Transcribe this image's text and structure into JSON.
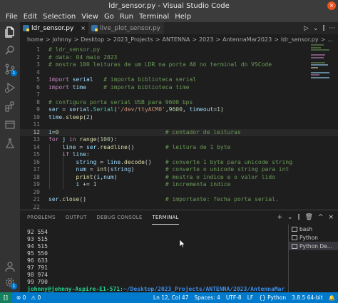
{
  "window": {
    "title": "ldr_sensor.py - Visual Studio Code",
    "close_glyph": "×"
  },
  "menu": [
    "File",
    "Edit",
    "Selection",
    "View",
    "Go",
    "Run",
    "Terminal",
    "Help"
  ],
  "tabs": [
    {
      "label": "ldr_sensor.py",
      "close": "×"
    },
    {
      "label": "live_plot_sensor.py"
    }
  ],
  "editor_actions": {
    "run": "▷",
    "run_dropdown": "⌄",
    "split": "⫿",
    "more": "···"
  },
  "breadcrumb": {
    "parts": [
      "home",
      "johnny",
      "Desktop",
      "2023_Projects",
      "ANTENNA",
      "2023",
      "AntennaMar2023",
      "ldr_sensor.py",
      "..."
    ],
    "separator": ">"
  },
  "code_lines": [
    {
      "num": "1",
      "code": "# ldr_sensor.py"
    },
    {
      "num": "2",
      "code": "# data: 04 maio 2023"
    },
    {
      "num": "3",
      "code": "# mostra 100 leituras de um LDR na porta A0 no terminal do VSCode"
    },
    {
      "num": "4",
      "code": ""
    },
    {
      "num": "5",
      "code": "import serial   # importa biblioteca serial"
    },
    {
      "num": "6",
      "code": "import time     # importa biblioteca time"
    },
    {
      "num": "7",
      "code": ""
    },
    {
      "num": "8",
      "code": "# configura porta serial USB para 9600 bps"
    },
    {
      "num": "9",
      "code": "ser = serial.Serial('/dev/ttyACM0',9600, timeout=1)"
    },
    {
      "num": "10",
      "code": "time.sleep(2)"
    },
    {
      "num": "11",
      "code": ""
    },
    {
      "num": "12",
      "code": "i=0                               # contador de leituras"
    },
    {
      "num": "13",
      "code": "for j in range(100):"
    },
    {
      "num": "14",
      "code": "    line = ser.readline()         # leitura de 1 byte"
    },
    {
      "num": "15",
      "code": "    if line:"
    },
    {
      "num": "16",
      "code": "        string = line.decode()    # converte 1 byte para unicode string"
    },
    {
      "num": "17",
      "code": "        num = int(string)         # converte o unicode string para int"
    },
    {
      "num": "18",
      "code": "        print(i,num)              # mostra o indice e o valor lido"
    },
    {
      "num": "19",
      "code": "        i += 1                    # incrementa indice"
    },
    {
      "num": "20",
      "code": ""
    },
    {
      "num": "21",
      "code": "ser.close()                       # importante: fecha porta serial."
    },
    {
      "num": "22",
      "code": ""
    }
  ],
  "current_line": "12",
  "panel": {
    "tabs": [
      "PROBLEMS",
      "OUTPUT",
      "DEBUG CONSOLE",
      "TERMINAL"
    ],
    "active_tab": "TERMINAL",
    "actions": {
      "new": "+",
      "dropdown": "⌄",
      "split": "⫿",
      "trash": "🗑",
      "maximize": "^",
      "close": "×"
    },
    "terminal_lines": [
      "92 554",
      "93 515",
      "94 515",
      "95 550",
      "96 633",
      "97 791",
      "98 974",
      "99 790"
    ],
    "prompt": {
      "user": "johnny@johnny-Aspire-E1-571",
      "colon": ":",
      "path": "~/Desktop/2023_Projects/ANTENNA/2023/AntennaMar2023",
      "symbol": "$"
    },
    "terminal_list": [
      "bash",
      "Python",
      "Python De..."
    ]
  },
  "status_bar": {
    "remote": "⁅⁆",
    "errors": "⊗ 0",
    "warnings": "⚠ 0",
    "line_col": "Ln 12, Col 47",
    "spaces": "Spaces: 4",
    "encoding": "UTF-8",
    "eol": "LF",
    "language": "{} Python",
    "interpreter": "3.8.5 64-bit",
    "bell": "🔔"
  },
  "activity_badges": {
    "source_control": "1",
    "settings": "1"
  },
  "icons": [
    "files-icon",
    "search-icon",
    "source-control-icon",
    "run-debug-icon",
    "extensions-icon",
    "explorer-icon",
    "testing-icon",
    "account-icon",
    "settings-icon"
  ]
}
